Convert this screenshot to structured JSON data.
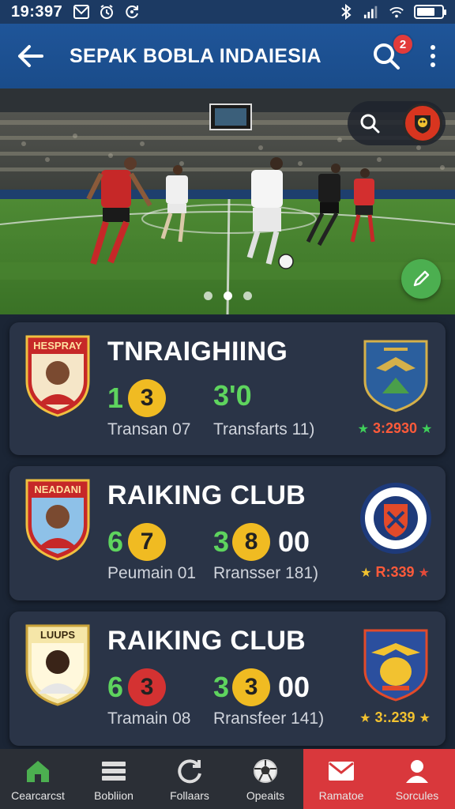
{
  "status_bar": {
    "time": "19:397",
    "battery_level": 0.75,
    "left_icons": [
      "mail-icon",
      "alarm-icon",
      "sync-icon"
    ],
    "right_icons": [
      "bluetooth-icon",
      "signal-icon",
      "wifi-icon",
      "battery-icon"
    ]
  },
  "app_bar": {
    "title": "SEPAK BOBLA INDAIESIA",
    "search_badge_count": "2"
  },
  "hero": {
    "image": "football-match-photo",
    "carousel_pages": 3,
    "active_page": 2
  },
  "cards": [
    {
      "badge_text": "HESPRAY",
      "title": "TNRAIGHIING",
      "score1_left": "1",
      "score1_circle": "3",
      "score2_left": "3'0",
      "score2_circle": "",
      "score2_extra": "",
      "sub_left": "Transan 07",
      "sub_right": "Transfarts 11)",
      "rating": "3:2930",
      "star_color": "#3fd05a",
      "rating_color": "#ff5a3a",
      "circle1_color": "yellow",
      "circle2_color": ""
    },
    {
      "badge_text": "NEADANI",
      "title": "RAIKING CLUB",
      "score1_left": "6",
      "score1_circle": "7",
      "score2_left": "3",
      "score2_circle": "8",
      "score2_extra": "00",
      "sub_left": "Peumain 01",
      "sub_right": "Rransser 181)",
      "rating": "R:339",
      "star_color": "#f2c230",
      "rating_color": "#ff5a3a",
      "circle1_color": "yellow",
      "circle2_color": "yellow"
    },
    {
      "badge_text": "LUUPS",
      "title": "RAIKING CLUB",
      "score1_left": "6",
      "score1_circle": "3",
      "score2_left": "3",
      "score2_circle": "3",
      "score2_extra": "00",
      "sub_left": "Tramain 08",
      "sub_right": "Rransfeer 141)",
      "rating": "3:.239",
      "star_color": "#f2c230",
      "rating_color": "#f2c230",
      "circle1_color": "red",
      "circle2_color": "yellow"
    }
  ],
  "bottom_nav": {
    "items": [
      {
        "label": "Cearcarcst",
        "icon": "home-icon"
      },
      {
        "label": "Bobliion",
        "icon": "list-icon"
      },
      {
        "label": "Follaars",
        "icon": "refresh-icon"
      },
      {
        "label": "Opeaits",
        "icon": "soccer-ball-icon"
      },
      {
        "label": "Ramatoe",
        "icon": "envelope-icon"
      },
      {
        "label": "Sorcules",
        "icon": "user-icon"
      }
    ],
    "highlight_color": "#d9383c"
  }
}
